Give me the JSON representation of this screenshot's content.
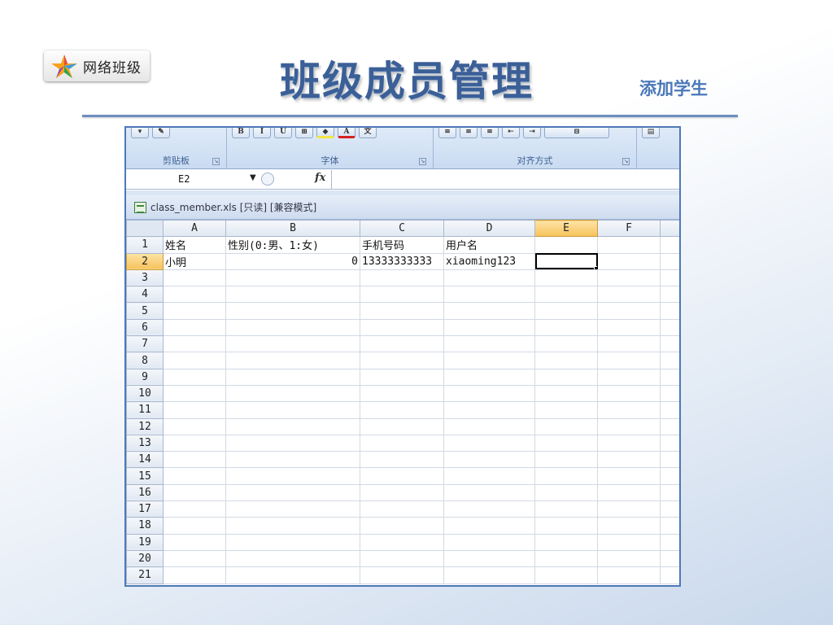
{
  "logo": {
    "text": "网络班级"
  },
  "slide": {
    "title": "班级成员管理",
    "subtitle": "添加学生"
  },
  "ribbon": {
    "groups": [
      {
        "label": "剪贴板"
      },
      {
        "label": "字体"
      },
      {
        "label": "对齐方式"
      }
    ]
  },
  "formula_bar": {
    "cell_ref": "E2",
    "fx": "fx"
  },
  "workbook": {
    "title": "class_member.xls  [只读]  [兼容模式]"
  },
  "sheet": {
    "selected_cell": "E2",
    "columns": [
      "A",
      "B",
      "C",
      "D",
      "E",
      "F",
      ""
    ],
    "rows": [
      {
        "num": "1",
        "cells": [
          "姓名",
          "性别(0:男、1:女)",
          "手机号码",
          "用户名",
          "",
          "",
          ""
        ]
      },
      {
        "num": "2",
        "cells": [
          "小明",
          "0",
          "13333333333",
          "xiaoming123",
          "",
          "",
          ""
        ]
      },
      {
        "num": "3",
        "cells": [
          "",
          "",
          "",
          "",
          "",
          "",
          ""
        ]
      },
      {
        "num": "4",
        "cells": [
          "",
          "",
          "",
          "",
          "",
          "",
          ""
        ]
      },
      {
        "num": "5",
        "cells": [
          "",
          "",
          "",
          "",
          "",
          "",
          ""
        ]
      },
      {
        "num": "6",
        "cells": [
          "",
          "",
          "",
          "",
          "",
          "",
          ""
        ]
      },
      {
        "num": "7",
        "cells": [
          "",
          "",
          "",
          "",
          "",
          "",
          ""
        ]
      },
      {
        "num": "8",
        "cells": [
          "",
          "",
          "",
          "",
          "",
          "",
          ""
        ]
      },
      {
        "num": "9",
        "cells": [
          "",
          "",
          "",
          "",
          "",
          "",
          ""
        ]
      },
      {
        "num": "10",
        "cells": [
          "",
          "",
          "",
          "",
          "",
          "",
          ""
        ]
      },
      {
        "num": "11",
        "cells": [
          "",
          "",
          "",
          "",
          "",
          "",
          ""
        ]
      },
      {
        "num": "12",
        "cells": [
          "",
          "",
          "",
          "",
          "",
          "",
          ""
        ]
      },
      {
        "num": "13",
        "cells": [
          "",
          "",
          "",
          "",
          "",
          "",
          ""
        ]
      },
      {
        "num": "14",
        "cells": [
          "",
          "",
          "",
          "",
          "",
          "",
          ""
        ]
      },
      {
        "num": "15",
        "cells": [
          "",
          "",
          "",
          "",
          "",
          "",
          ""
        ]
      },
      {
        "num": "16",
        "cells": [
          "",
          "",
          "",
          "",
          "",
          "",
          ""
        ]
      },
      {
        "num": "17",
        "cells": [
          "",
          "",
          "",
          "",
          "",
          "",
          ""
        ]
      },
      {
        "num": "18",
        "cells": [
          "",
          "",
          "",
          "",
          "",
          "",
          ""
        ]
      },
      {
        "num": "19",
        "cells": [
          "",
          "",
          "",
          "",
          "",
          "",
          ""
        ]
      },
      {
        "num": "20",
        "cells": [
          "",
          "",
          "",
          "",
          "",
          "",
          ""
        ]
      },
      {
        "num": "21",
        "cells": [
          "",
          "",
          "",
          "",
          "",
          "",
          ""
        ]
      }
    ]
  }
}
